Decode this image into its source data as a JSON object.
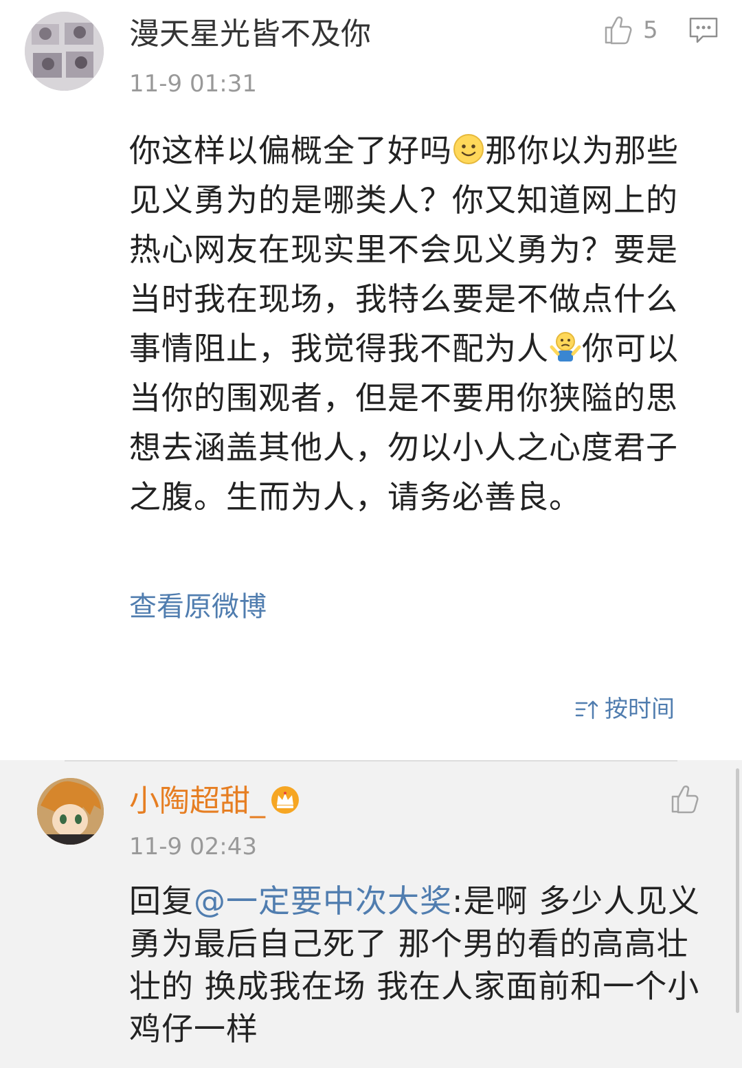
{
  "main_comment": {
    "username": "漫天星光皆不及你",
    "timestamp": "11-9 01:31",
    "like_count": "5",
    "text_part1": "你这样以偏概全了好吗",
    "text_part2": "那你以为那些见义勇为的是哪类人？你又知道网上的热心网友在现实里不会见义勇为？要是当时我在现场，我特么要是不做点什么事情阻止，我觉得我不配为人",
    "text_part3": "你可以当你的围观者，但是不要用你狭隘的思想去涵盖其他人，勿以小人之心度君子之腹。生而为人，请务必善良。",
    "emoji1": "smile-emoji",
    "emoji2": "shrug-emoji"
  },
  "view_original_label": "查看原微博",
  "sort": {
    "label": "按时间",
    "icon": "sort-icon"
  },
  "reply": {
    "username": "小陶超甜_",
    "badge": "vip-crown-icon",
    "timestamp": "11-9 02:43",
    "prefix": "回复",
    "mention": "@一定要中次大奖",
    "body": ":是啊 多少人见义勇为最后自己死了 那个男的看的高高壮壮的 换成我在场 我在人家面前和一个小鸡仔一样"
  },
  "colors": {
    "link_blue": "#507daf",
    "reply_name_orange": "#e67e22",
    "meta_gray": "#999999",
    "reply_bg": "#f2f2f2"
  }
}
